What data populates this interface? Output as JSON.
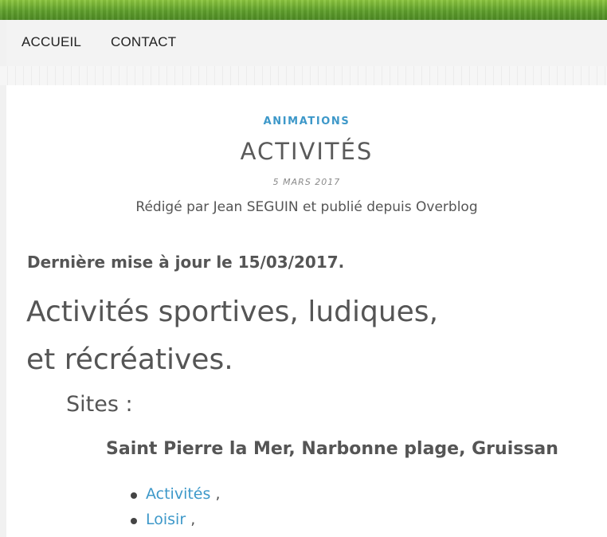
{
  "nav": {
    "items": [
      {
        "label": "ACCUEIL"
      },
      {
        "label": "CONTACT"
      }
    ]
  },
  "article": {
    "category": "ANIMATIONS",
    "title": "ACTIVITÉS",
    "date": "5 MARS 2017",
    "byline": "Rédigé par Jean SEGUIN et publié depuis Overblog",
    "update": "Dernière mise à jour le 15/03/2017.",
    "headline_line1": "Activités sportives, ludiques,",
    "headline_line2": "et récréatives.",
    "sites_heading": "Sites :",
    "places": "Saint Pierre la Mer, Narbonne plage, Gruissan",
    "tags": [
      {
        "label": "Activités",
        "sep": ","
      },
      {
        "label": "Loisir",
        "sep": ","
      }
    ]
  },
  "colors": {
    "link": "#3d98c9",
    "text": "#555555",
    "banner": "#6aa832"
  }
}
